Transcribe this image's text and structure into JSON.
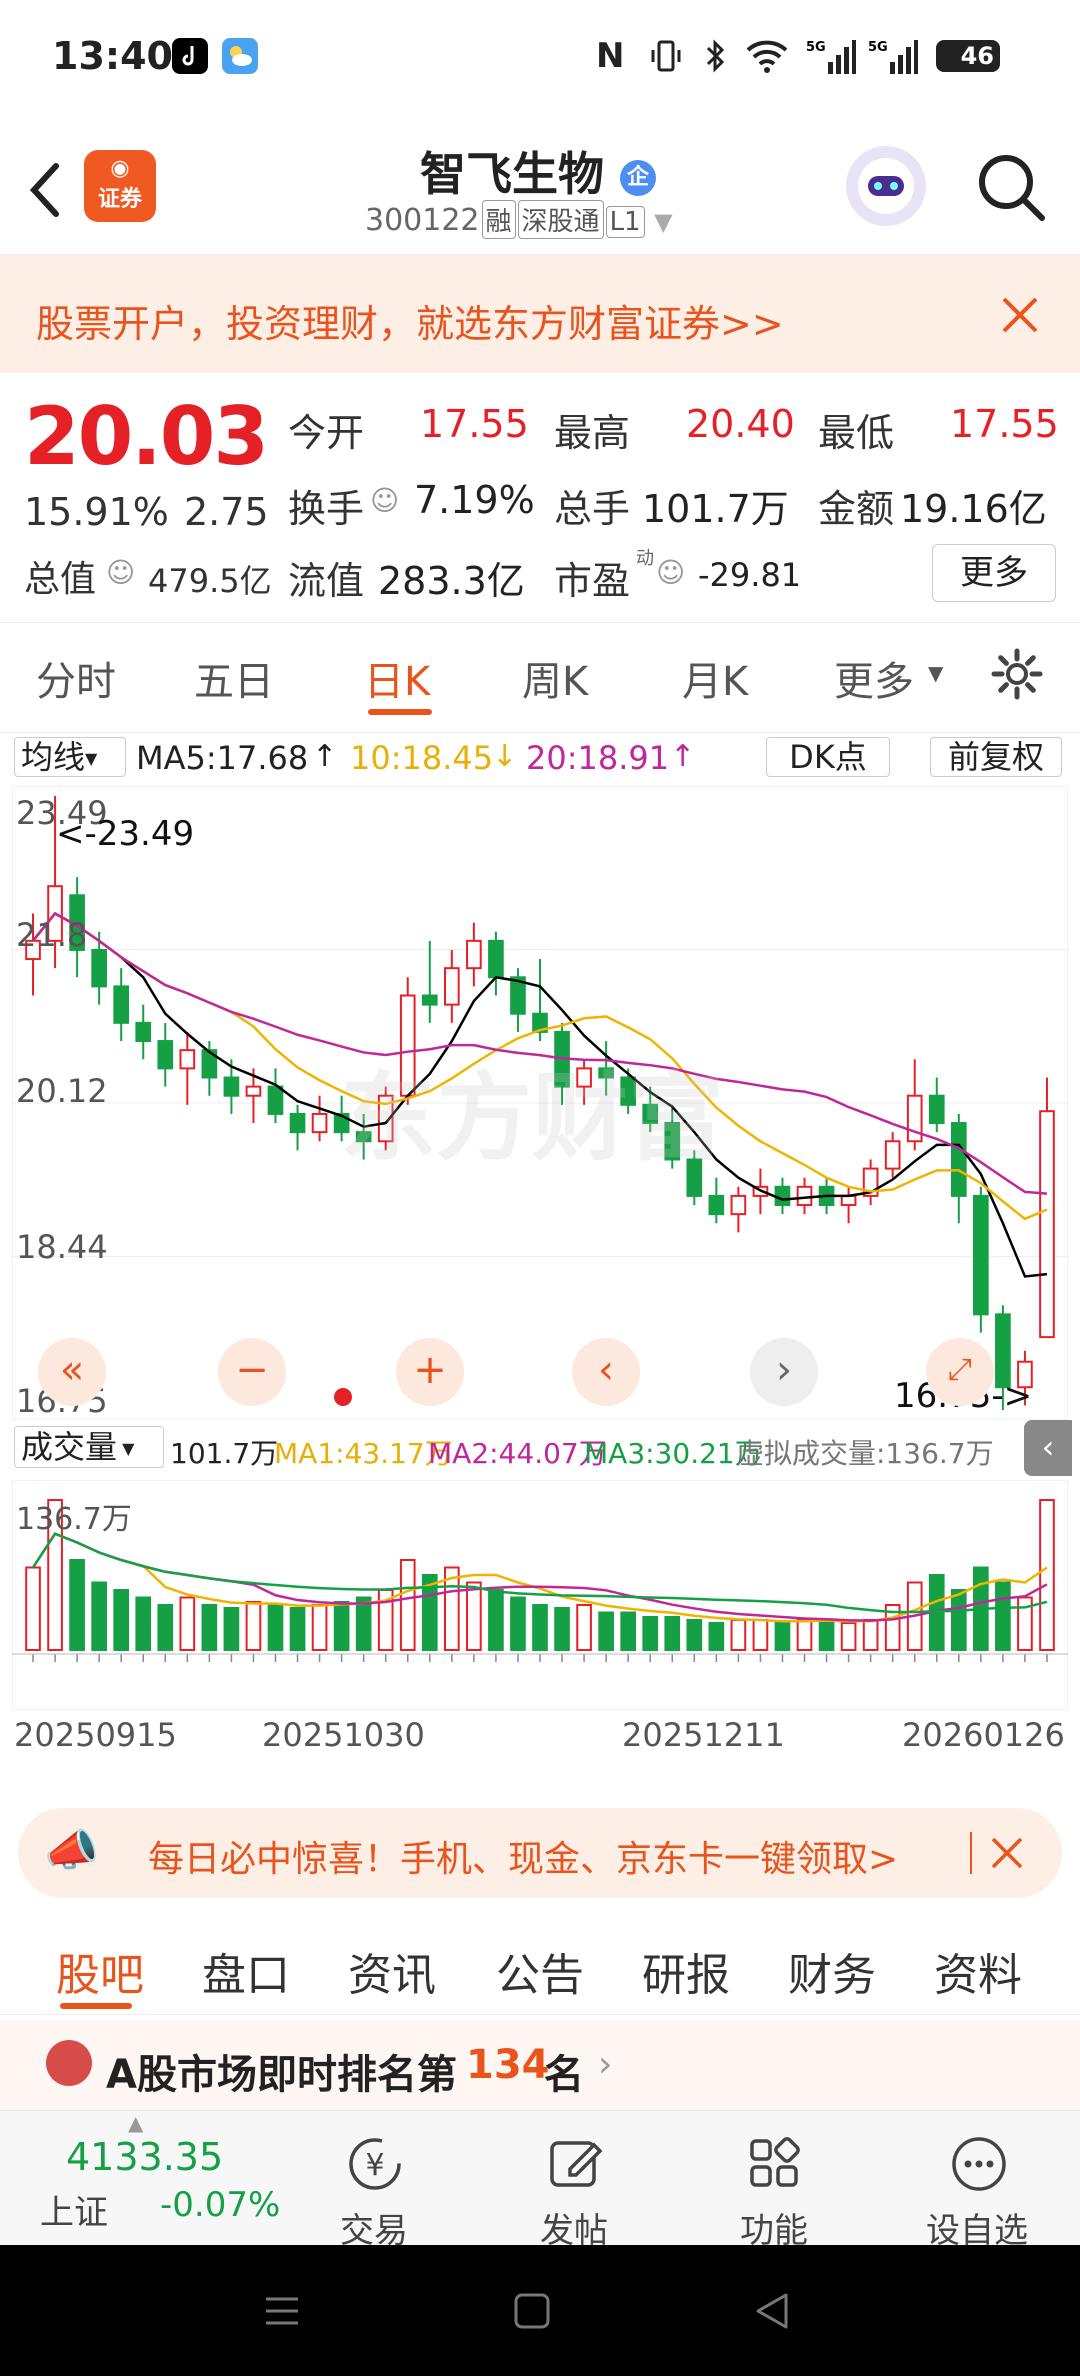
{
  "status_bar": {
    "time": "13:40",
    "battery": "46",
    "net1": "5G",
    "net2": "5G"
  },
  "header": {
    "title": "智飞生物",
    "enterprise_badge": "企",
    "code": "300122",
    "tags": [
      "融",
      "深股通",
      "L1"
    ],
    "broker_logo": "证券"
  },
  "banner": {
    "text": "股票开户，投资理财，就选东方财富证券>>"
  },
  "quote": {
    "price": "20.03",
    "change_pct": "15.91%",
    "change": "2.75",
    "open_label": "今开",
    "open": "17.55",
    "high_label": "最高",
    "high": "20.40",
    "low_label": "最低",
    "low": "17.55",
    "turnover_label": "换手",
    "turnover": "7.19%",
    "volume_label": "总手",
    "volume": "101.7万",
    "amount_label": "金额",
    "amount": "19.16亿",
    "mktcap_label": "总值",
    "mktcap": "479.5亿",
    "float_label": "流值",
    "float": "283.3亿",
    "pe_label": "市盈",
    "pe_sup": "动",
    "pe": "-29.81",
    "more_button": "更多"
  },
  "kline_tabs": [
    "分时",
    "五日",
    "日K",
    "周K",
    "月K",
    "更多"
  ],
  "kline_tab_active": "日K",
  "ma_legend": {
    "indicator": "均线",
    "ma5": "MA5:17.68",
    "ma10": "10:18.45",
    "ma20": "20:18.91",
    "dk_button": "DK点",
    "adjust_button": "前复权"
  },
  "chart_axis": {
    "y_ticks": [
      "23.49",
      "21.8",
      "20.12",
      "18.44",
      "16.75"
    ],
    "max_marker": "<-23.49",
    "min_marker": "16.75->"
  },
  "volume_legend": {
    "indicator": "成交量",
    "vol": "101.7万",
    "ma1": "MA1:43.17万",
    "ma2": "MA2:44.07万",
    "ma3": "MA3:30.21万",
    "virtual": "虚拟成交量:136.7万",
    "max_label": "136.7万"
  },
  "x_dates": [
    "20250915",
    "20251030",
    "20251211",
    "20260126"
  ],
  "chart_data": {
    "type": "candlestick",
    "y_range": [
      16.75,
      23.49
    ],
    "x_labels": [
      "20250915",
      "20251030",
      "20251211",
      "20260126"
    ],
    "colors": {
      "up": "#e52127",
      "down": "#16a046",
      "ma5": "#000000",
      "ma10": "#f0b400",
      "ma20": "#c0279b"
    },
    "candles": [
      {
        "o": 21.7,
        "h": 22.2,
        "l": 21.3,
        "c": 21.9
      },
      {
        "o": 21.9,
        "h": 23.49,
        "l": 21.6,
        "c": 22.5
      },
      {
        "o": 22.4,
        "h": 22.6,
        "l": 21.5,
        "c": 21.8
      },
      {
        "o": 21.8,
        "h": 22.0,
        "l": 21.2,
        "c": 21.4
      },
      {
        "o": 21.4,
        "h": 21.6,
        "l": 20.8,
        "c": 21.0
      },
      {
        "o": 21.0,
        "h": 21.2,
        "l": 20.6,
        "c": 20.8
      },
      {
        "o": 20.8,
        "h": 21.0,
        "l": 20.3,
        "c": 20.5
      },
      {
        "o": 20.5,
        "h": 20.9,
        "l": 20.1,
        "c": 20.7
      },
      {
        "o": 20.7,
        "h": 20.8,
        "l": 20.2,
        "c": 20.4
      },
      {
        "o": 20.4,
        "h": 20.6,
        "l": 20.0,
        "c": 20.2
      },
      {
        "o": 20.2,
        "h": 20.5,
        "l": 19.9,
        "c": 20.3
      },
      {
        "o": 20.3,
        "h": 20.5,
        "l": 19.9,
        "c": 20.0
      },
      {
        "o": 20.0,
        "h": 20.1,
        "l": 19.6,
        "c": 19.8
      },
      {
        "o": 19.8,
        "h": 20.2,
        "l": 19.7,
        "c": 20.0
      },
      {
        "o": 20.0,
        "h": 20.2,
        "l": 19.7,
        "c": 19.8
      },
      {
        "o": 19.8,
        "h": 20.0,
        "l": 19.5,
        "c": 19.7
      },
      {
        "o": 19.7,
        "h": 20.3,
        "l": 19.6,
        "c": 20.2
      },
      {
        "o": 20.2,
        "h": 21.5,
        "l": 20.1,
        "c": 21.3
      },
      {
        "o": 21.3,
        "h": 21.9,
        "l": 21.0,
        "c": 21.2
      },
      {
        "o": 21.2,
        "h": 21.8,
        "l": 21.0,
        "c": 21.6
      },
      {
        "o": 21.6,
        "h": 22.1,
        "l": 21.4,
        "c": 21.9
      },
      {
        "o": 21.9,
        "h": 22.0,
        "l": 21.3,
        "c": 21.5
      },
      {
        "o": 21.5,
        "h": 21.6,
        "l": 20.9,
        "c": 21.1
      },
      {
        "o": 21.1,
        "h": 21.7,
        "l": 20.8,
        "c": 20.9
      },
      {
        "o": 20.9,
        "h": 21.0,
        "l": 20.1,
        "c": 20.3
      },
      {
        "o": 20.3,
        "h": 20.6,
        "l": 20.1,
        "c": 20.5
      },
      {
        "o": 20.5,
        "h": 20.8,
        "l": 20.2,
        "c": 20.4
      },
      {
        "o": 20.4,
        "h": 20.5,
        "l": 20.0,
        "c": 20.1
      },
      {
        "o": 20.1,
        "h": 20.3,
        "l": 19.8,
        "c": 19.9
      },
      {
        "o": 19.9,
        "h": 20.1,
        "l": 19.4,
        "c": 19.5
      },
      {
        "o": 19.5,
        "h": 19.6,
        "l": 19.0,
        "c": 19.1
      },
      {
        "o": 19.1,
        "h": 19.3,
        "l": 18.8,
        "c": 18.9
      },
      {
        "o": 18.9,
        "h": 19.2,
        "l": 18.7,
        "c": 19.1
      },
      {
        "o": 19.1,
        "h": 19.4,
        "l": 18.9,
        "c": 19.2
      },
      {
        "o": 19.2,
        "h": 19.3,
        "l": 18.9,
        "c": 19.0
      },
      {
        "o": 19.0,
        "h": 19.3,
        "l": 18.9,
        "c": 19.2
      },
      {
        "o": 19.2,
        "h": 19.3,
        "l": 18.9,
        "c": 19.0
      },
      {
        "o": 19.0,
        "h": 19.2,
        "l": 18.8,
        "c": 19.1
      },
      {
        "o": 19.1,
        "h": 19.5,
        "l": 19.0,
        "c": 19.4
      },
      {
        "o": 19.4,
        "h": 19.8,
        "l": 19.3,
        "c": 19.7
      },
      {
        "o": 19.7,
        "h": 20.6,
        "l": 19.6,
        "c": 20.2
      },
      {
        "o": 20.2,
        "h": 20.4,
        "l": 19.8,
        "c": 19.9
      },
      {
        "o": 19.9,
        "h": 20.0,
        "l": 18.8,
        "c": 19.1
      },
      {
        "o": 19.1,
        "h": 19.2,
        "l": 17.6,
        "c": 17.8
      },
      {
        "o": 17.8,
        "h": 17.9,
        "l": 16.75,
        "c": 17.0
      },
      {
        "o": 17.0,
        "h": 17.4,
        "l": 16.8,
        "c": 17.28
      },
      {
        "o": 17.55,
        "h": 20.4,
        "l": 17.55,
        "c": 20.03
      }
    ],
    "volume": [
      0.55,
      1.0,
      0.6,
      0.45,
      0.4,
      0.35,
      0.3,
      0.35,
      0.3,
      0.28,
      0.32,
      0.3,
      0.28,
      0.3,
      0.32,
      0.35,
      0.4,
      0.6,
      0.5,
      0.55,
      0.45,
      0.4,
      0.35,
      0.3,
      0.28,
      0.3,
      0.25,
      0.25,
      0.22,
      0.22,
      0.2,
      0.18,
      0.2,
      0.2,
      0.18,
      0.2,
      0.2,
      0.18,
      0.2,
      0.3,
      0.45,
      0.5,
      0.4,
      0.55,
      0.45,
      0.35,
      1.0
    ]
  },
  "promo": {
    "text": "每日必中惊喜！手机、现金、京东卡一键领取>"
  },
  "bottom_tabs": [
    "股吧",
    "盘口",
    "资讯",
    "公告",
    "研报",
    "财务",
    "资料"
  ],
  "bottom_tab_active": "股吧",
  "rank": {
    "prefix": "A股市场即时排名第",
    "number": "134",
    "suffix": "名"
  },
  "bottom_nav": {
    "index_value": "4133.35",
    "index_name": "上证",
    "index_change": "-0.07%",
    "items": [
      "交易",
      "发帖",
      "功能",
      "设自选"
    ]
  },
  "watermark": "东方财富"
}
